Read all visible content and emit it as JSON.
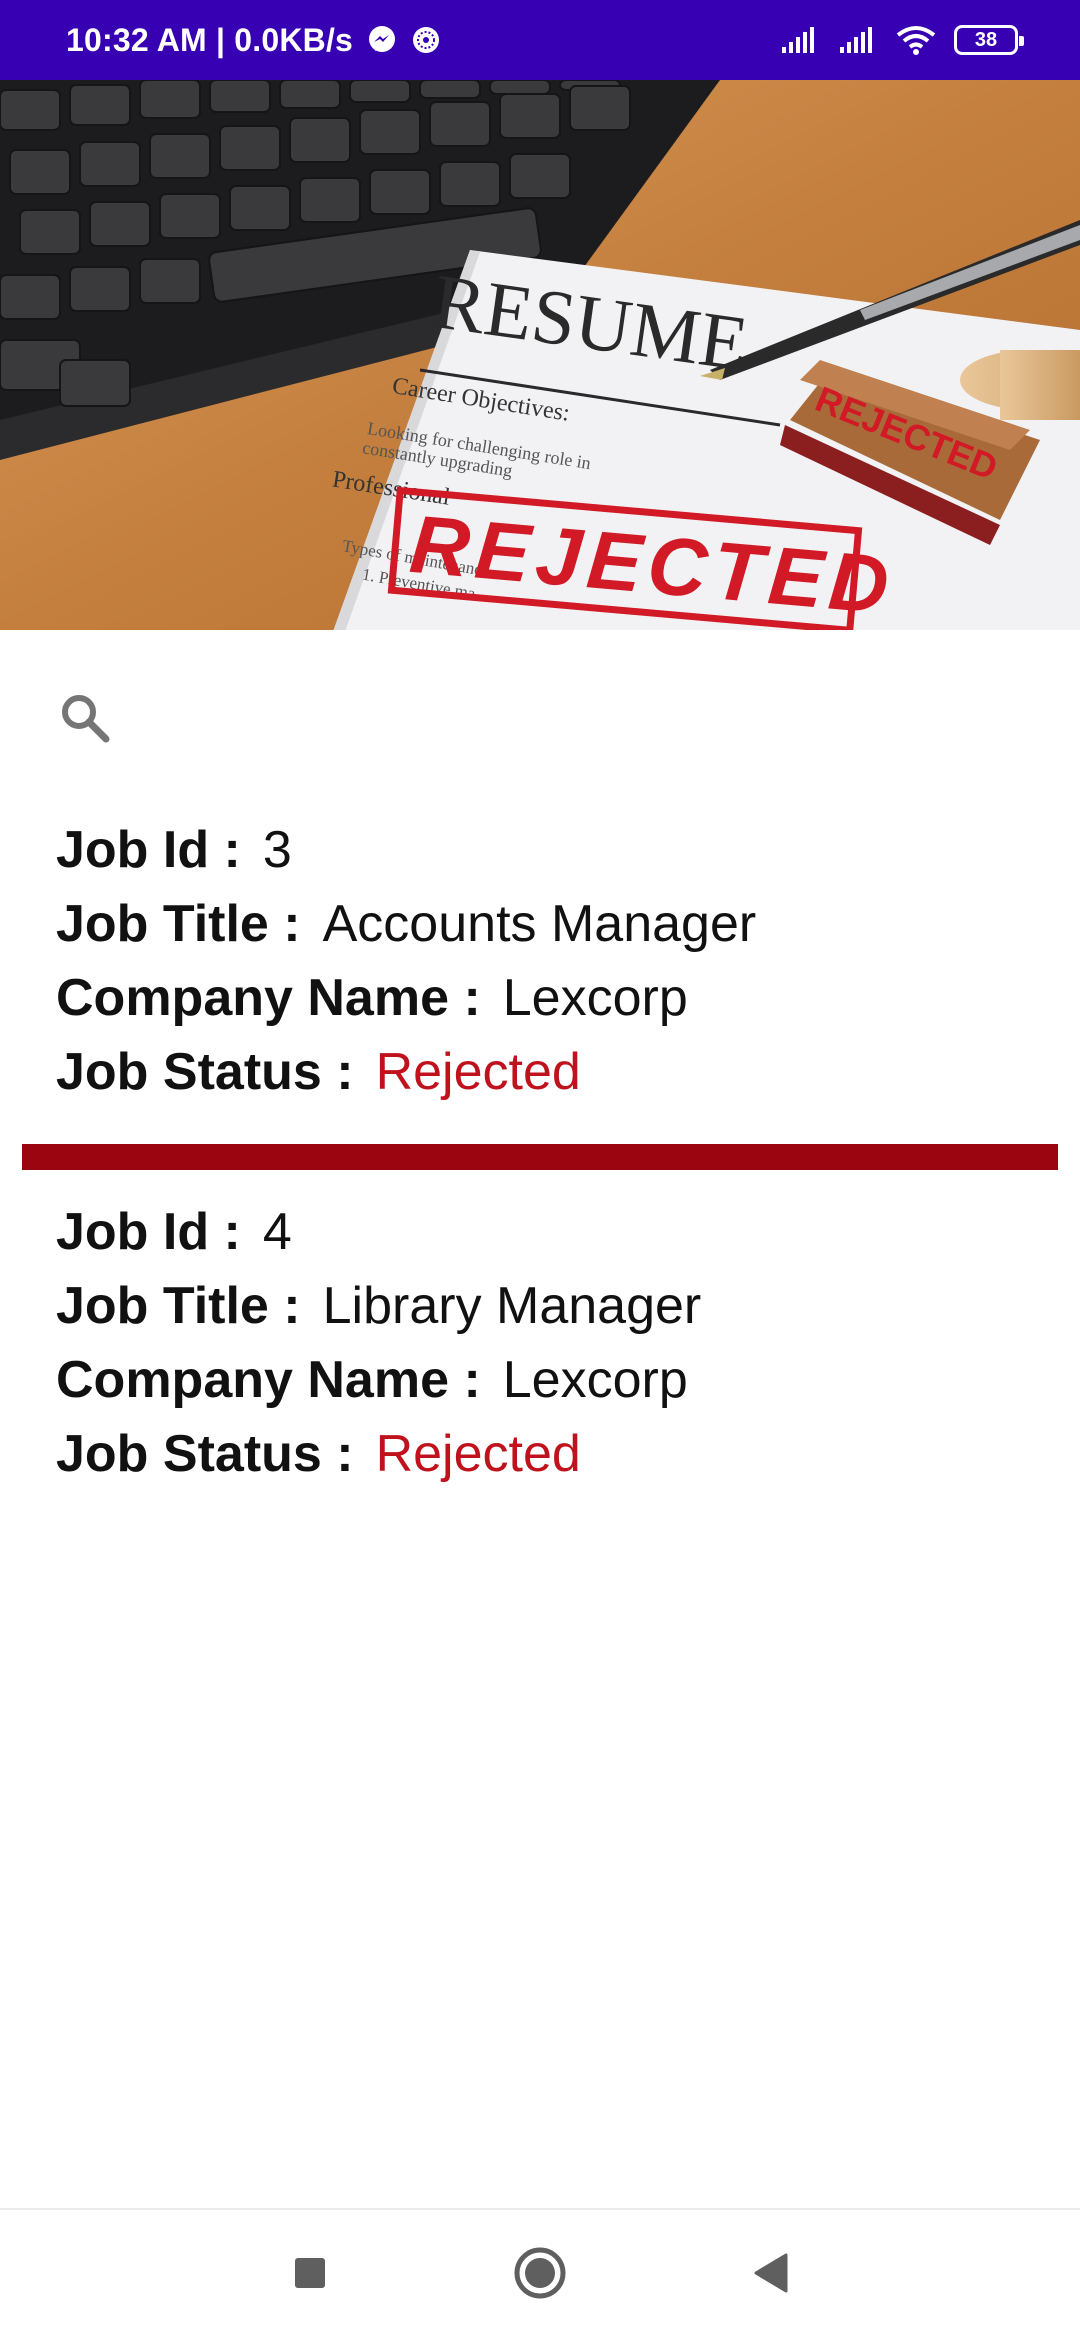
{
  "status_bar": {
    "time_speed": "10:32 AM | 0.0KB/s",
    "battery_level": "38",
    "color": "#3700b3",
    "icons": [
      "messenger-icon",
      "vpn-icon",
      "signal-icon",
      "signal-icon",
      "wifi-icon",
      "battery-icon"
    ]
  },
  "hero_image": {
    "heading": "RESUME",
    "subheading": "Career Objectives:",
    "small_text_1": "Looking for challenging role in",
    "small_text_2": "constantly upgrading",
    "section_text": "Professional",
    "bullet_text_1": "Types of maintenance",
    "bullet_text_2": "1. Preventive ma",
    "stamp_text": "REJECTED",
    "rubber_stamp_text": "REJECTED"
  },
  "search": {
    "icon": "search-icon"
  },
  "jobs": [
    {
      "id_label": "Job Id :",
      "id_value": "3",
      "title_label": "Job Title :",
      "title_value": "Accounts Manager",
      "company_label": "Company Name :",
      "company_value": "Lexcorp",
      "status_label": "Job Status :",
      "status_value": "Rejected"
    },
    {
      "id_label": "Job Id :",
      "id_value": "4",
      "title_label": "Job Title :",
      "title_value": "Library Manager",
      "company_label": "Company Name :",
      "company_value": "Lexcorp",
      "status_label": "Job Status :",
      "status_value": "Rejected"
    }
  ],
  "colors": {
    "separator": "#9a0510",
    "rejected": "#c0121d"
  },
  "nav_bar": {
    "icons": [
      "recents-square-icon",
      "home-circle-icon",
      "back-triangle-icon"
    ]
  }
}
